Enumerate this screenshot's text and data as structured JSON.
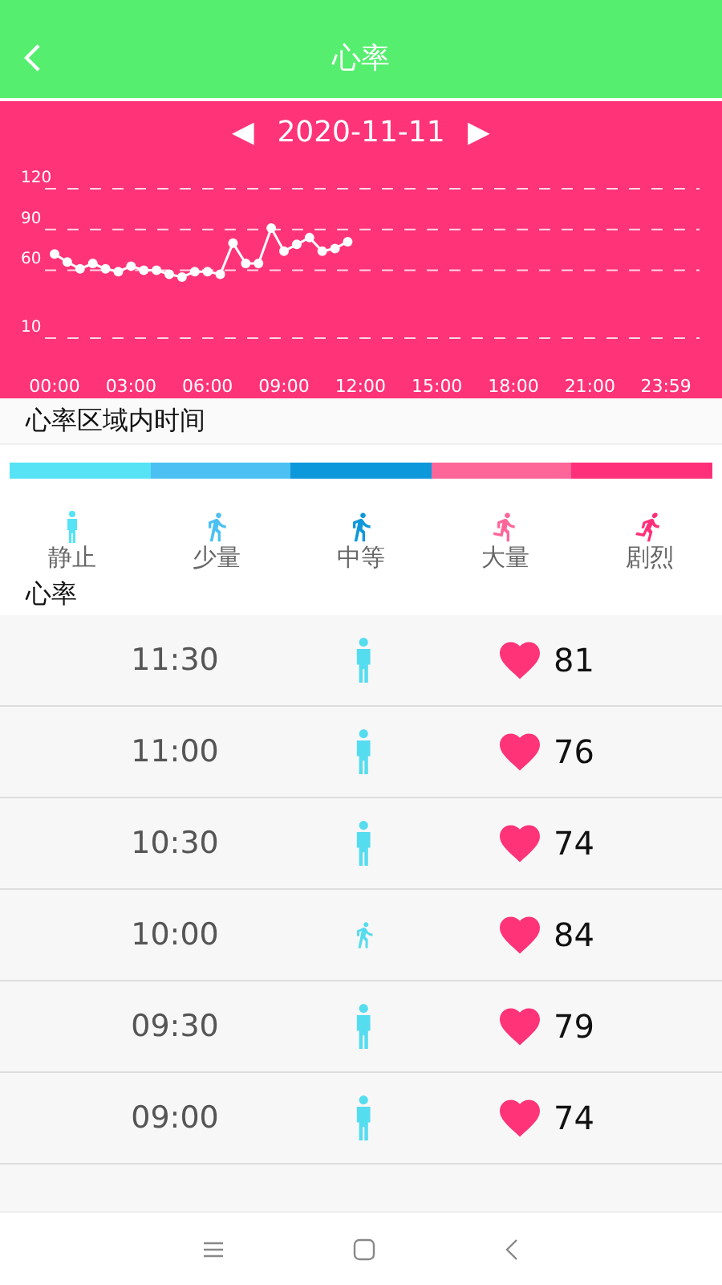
{
  "header": {
    "title": "心率"
  },
  "date_nav": {
    "prev": "◀",
    "date": "2020-11-11",
    "next": "▶"
  },
  "chart_data": {
    "type": "line",
    "x": [
      0,
      0.5,
      1,
      1.5,
      2,
      2.5,
      3,
      3.5,
      4,
      4.5,
      5,
      5.5,
      6,
      6.5,
      7,
      7.5,
      8,
      8.5,
      9,
      9.5,
      10,
      10.5,
      11,
      11.5
    ],
    "grid": true,
    "xlim": [
      -0.378,
      25.3
    ],
    "ylim": [
      10,
      120
    ],
    "series": [
      {
        "color": "#ffffff",
        "marker": "circle",
        "values": [
          72,
          66,
          61,
          65,
          61,
          59,
          63,
          60,
          60,
          57,
          55,
          59,
          59,
          57,
          80,
          65,
          65,
          91,
          74,
          79,
          84,
          74,
          76,
          81
        ]
      }
    ],
    "xticks": [
      {
        "value": 0,
        "label": "00:00"
      },
      {
        "value": 3,
        "label": "03:00"
      },
      {
        "value": 6,
        "label": "06:00"
      },
      {
        "value": 9,
        "label": "09:00"
      },
      {
        "value": 12,
        "label": "12:00"
      },
      {
        "value": 15,
        "label": "15:00"
      },
      {
        "value": 18,
        "label": "18:00"
      },
      {
        "value": 21,
        "label": "21:00"
      },
      {
        "value": 23.983,
        "label": "23:59"
      }
    ],
    "yticks": [
      10,
      60,
      90,
      120
    ]
  },
  "zones": {
    "title": "心率区域内时间",
    "levels": [
      {
        "label": "静止",
        "kind": "stand",
        "color": "#55e3f5"
      },
      {
        "label": "少量",
        "kind": "walk",
        "color": "#4cc0f2"
      },
      {
        "label": "中等",
        "kind": "brisk",
        "color": "#0e98dc"
      },
      {
        "label": "大量",
        "kind": "run",
        "color": "#fe6699"
      },
      {
        "label": "剧烈",
        "kind": "sprint",
        "color": "#ff2f79"
      }
    ]
  },
  "list": {
    "title": "心率",
    "rows": [
      {
        "time": "11:30",
        "kind": "stand",
        "value": "81"
      },
      {
        "time": "11:00",
        "kind": "stand",
        "value": "76"
      },
      {
        "time": "10:30",
        "kind": "stand",
        "value": "74"
      },
      {
        "time": "10:00",
        "kind": "walk",
        "value": "84"
      },
      {
        "time": "09:30",
        "kind": "stand",
        "value": "79"
      },
      {
        "time": "09:00",
        "kind": "stand",
        "value": "74"
      }
    ]
  }
}
